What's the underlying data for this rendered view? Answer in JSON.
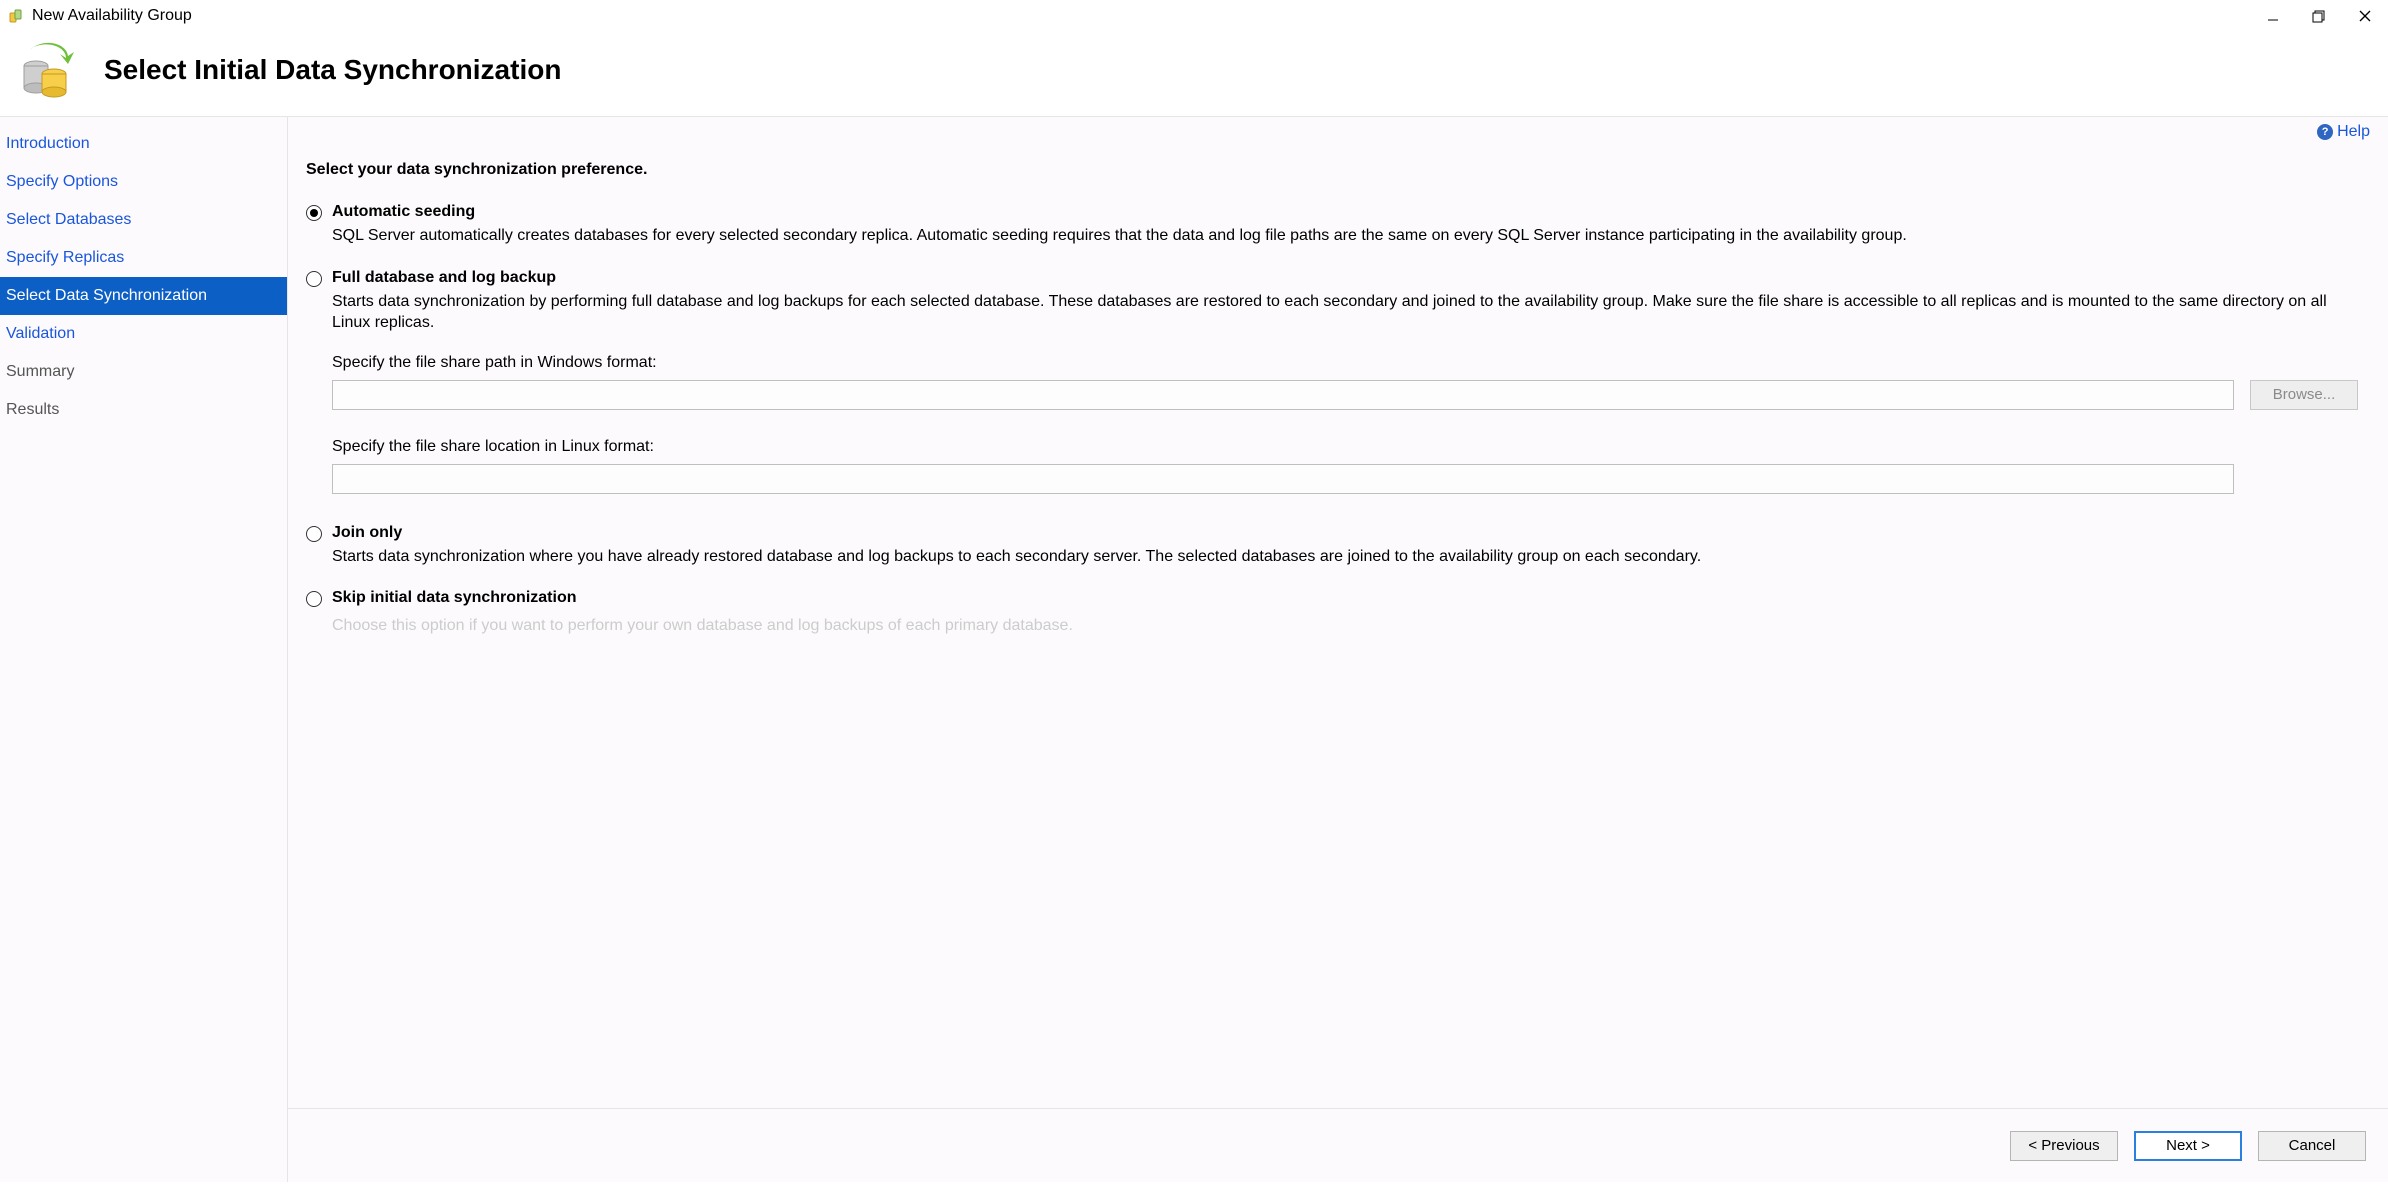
{
  "window": {
    "title": "New Availability Group"
  },
  "header": {
    "title": "Select Initial Data Synchronization"
  },
  "sidebar": {
    "items": [
      {
        "label": "Introduction",
        "key": "introduction"
      },
      {
        "label": "Specify Options",
        "key": "specify-options"
      },
      {
        "label": "Select Databases",
        "key": "select-databases"
      },
      {
        "label": "Specify Replicas",
        "key": "specify-replicas"
      },
      {
        "label": "Select Data Synchronization",
        "key": "select-data-synchronization",
        "selected": true
      },
      {
        "label": "Validation",
        "key": "validation"
      },
      {
        "label": "Summary",
        "key": "summary",
        "muted": true
      },
      {
        "label": "Results",
        "key": "results",
        "muted": true
      }
    ]
  },
  "help": {
    "label": "Help"
  },
  "content": {
    "prompt": "Select your data synchronization preference.",
    "options": [
      {
        "key": "automatic-seeding",
        "selected": true,
        "title": "Automatic seeding",
        "desc": "SQL Server automatically creates databases for every selected secondary replica. Automatic seeding requires that the data and log file paths are the same on every SQL Server instance participating in the availability group."
      },
      {
        "key": "full-backup",
        "selected": false,
        "title": "Full database and log backup",
        "desc": "Starts data synchronization by performing full database and log backups for each selected database. These databases are restored to each secondary and joined to the availability group. Make sure the file share is accessible to all replicas and is mounted to the same directory on all Linux replicas.",
        "windows_label": "Specify the file share path in Windows format:",
        "windows_value": "",
        "browse_label": "Browse...",
        "linux_label": "Specify the file share location in Linux format:",
        "linux_value": ""
      },
      {
        "key": "join-only",
        "selected": false,
        "title": "Join only",
        "desc": "Starts data synchronization where you have already restored database and log backups to each secondary server. The selected databases are joined to the availability group on each secondary."
      },
      {
        "key": "skip",
        "selected": false,
        "title": "Skip initial data synchronization",
        "desc": "Choose this option if you want to perform your own database and log backups of each primary database."
      }
    ]
  },
  "footer": {
    "previous": "< Previous",
    "next": "Next >",
    "cancel": "Cancel"
  }
}
